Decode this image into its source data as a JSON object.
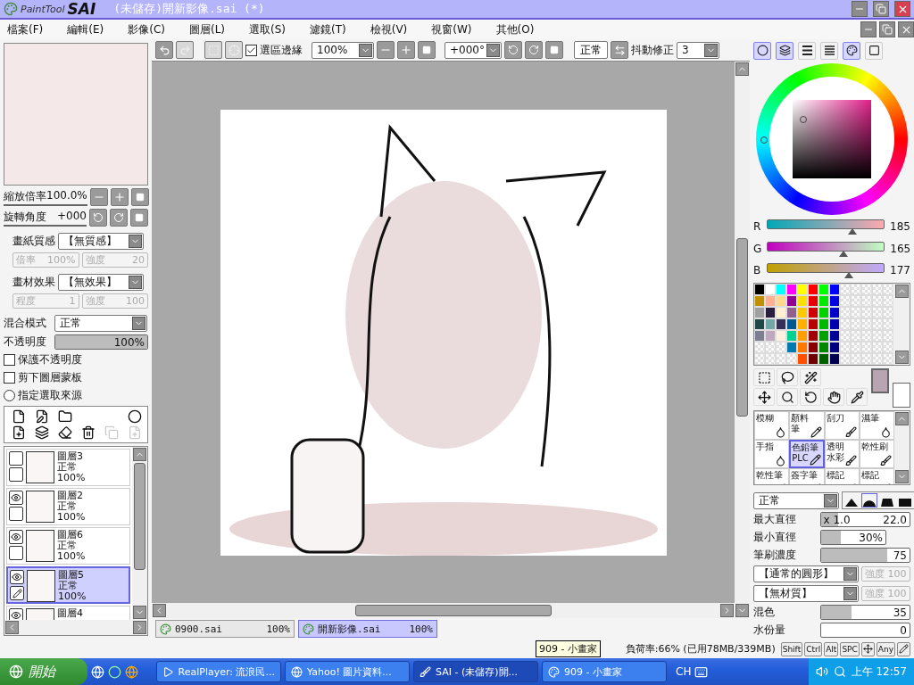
{
  "title_bar": {
    "app_name_1": "PaintTool",
    "app_name_2": "SAI",
    "title": "(未儲存)開新影像.sai (*)"
  },
  "menu": [
    "檔案(F)",
    "編輯(E)",
    "影像(C)",
    "圖層(L)",
    "選取(S)",
    "濾鏡(T)",
    "檢視(V)",
    "視窗(W)",
    "其他(O)"
  ],
  "toolbar": {
    "selection_edge": {
      "label": "選區邊緣",
      "checked": true
    },
    "zoom": "100%",
    "angle": "+000°",
    "blend_button": "正常",
    "stabilizer_label": "抖動修正",
    "stabilizer": "3"
  },
  "navigator": {
    "zoom_label": "縮放倍率",
    "zoom": "100.0%",
    "angle_label": "旋轉角度",
    "angle": "+000"
  },
  "paper": {
    "label": "畫紙質感",
    "value": "【無質感】",
    "sub": [
      {
        "label": "倍率",
        "value": "100%"
      },
      {
        "label": "強度",
        "value": "20"
      }
    ],
    "disabled": true
  },
  "effect": {
    "label": "畫材效果",
    "value": "【無效果】",
    "sub": [
      {
        "label": "程度",
        "value": "1"
      },
      {
        "label": "強度",
        "value": "100"
      }
    ],
    "disabled": true
  },
  "layer_props": {
    "blend_label": "混合模式",
    "blend": "正常",
    "opacity_label": "不透明度",
    "opacity": "100%",
    "level": 1
  },
  "options": [
    {
      "kind": "checkbox",
      "label": "保護不透明度",
      "checked": false
    },
    {
      "kind": "checkbox",
      "label": "剪下圖層蒙板",
      "checked": false
    },
    {
      "kind": "radio",
      "label": "指定選取來源",
      "checked": false
    }
  ],
  "layers": [
    {
      "name": "圖層3",
      "mode": "正常",
      "opacity": "100%",
      "visible": false,
      "selected": false,
      "editing": false
    },
    {
      "name": "圖層2",
      "mode": "正常",
      "opacity": "100%",
      "visible": true,
      "selected": false,
      "editing": false
    },
    {
      "name": "圖層6",
      "mode": "正常",
      "opacity": "100%",
      "visible": true,
      "selected": false,
      "editing": false
    },
    {
      "name": "圖層5",
      "mode": "正常",
      "opacity": "100%",
      "visible": true,
      "selected": true,
      "editing": true
    },
    {
      "name": "圖層4",
      "visible": true,
      "selected": false
    }
  ],
  "document_tabs": [
    {
      "label": "0900.sai",
      "zoom": "100%",
      "selected": false
    },
    {
      "label": "開新影像.sai",
      "zoom": "100%",
      "selected": true
    }
  ],
  "color_modes": [
    {
      "kind": "wheel",
      "selected": true
    },
    {
      "kind": "rgb",
      "selected": true
    },
    {
      "kind": "hsv",
      "selected": false
    },
    {
      "kind": "bars",
      "selected": false
    },
    {
      "kind": "swatches",
      "selected": true
    },
    {
      "kind": "scratchpad",
      "selected": false
    }
  ],
  "rgb": [
    {
      "channel": "R",
      "value": "185",
      "level": 0.725
    },
    {
      "channel": "G",
      "value": "165",
      "level": 0.647
    },
    {
      "channel": "B",
      "value": "177",
      "level": 0.694
    }
  ],
  "palette": [
    [
      {
        "color": "#000000"
      },
      {
        "color": "#ffffff"
      },
      {
        "color": "#00ffff"
      },
      {
        "color": "#ff00ff"
      },
      {
        "color": "#ffff00"
      },
      {
        "color": "#ff0000"
      },
      {
        "color": "#00ff00"
      },
      {
        "color": "#0000ff"
      }
    ],
    [
      {
        "color": "#c09000"
      },
      {
        "color": "#ffb090"
      },
      {
        "color": "#ffd890"
      },
      {
        "color": "#900090"
      },
      {
        "color": "#ffe000"
      },
      {
        "color": "#e80000"
      },
      {
        "color": "#00e800"
      },
      {
        "color": "#0000e0"
      }
    ],
    [
      {
        "color": "#a0a0a0"
      },
      {
        "color": "#2a1e40"
      },
      {
        "color": "#fff0d0"
      },
      {
        "color": "#906090"
      },
      {
        "color": "#ffc800"
      },
      {
        "color": "#d00000"
      },
      {
        "color": "#00d000"
      },
      {
        "color": "#0000c8"
      }
    ],
    [
      {
        "color": "#204848"
      },
      {
        "color": "#70a8a8"
      },
      {
        "color": "#343058"
      },
      {
        "color": "#005890"
      },
      {
        "color": "#ffb000"
      },
      {
        "color": "#b80000"
      },
      {
        "color": "#00b800"
      },
      {
        "color": "#0000b0"
      }
    ],
    [
      {
        "color": "#7a7e90"
      },
      {
        "color": "#c0a8c0"
      },
      {
        "color": "#fff0e0"
      },
      {
        "color": "#00d090"
      },
      {
        "color": "#ffa000"
      },
      {
        "color": "#a00000"
      },
      {
        "color": "#00a000"
      },
      {
        "color": "#000098"
      }
    ],
    [
      {
        "empty": true
      },
      {
        "empty": true
      },
      {
        "empty": true
      },
      {
        "color": "#0078b0"
      },
      {
        "color": "#ff7800"
      },
      {
        "color": "#880000"
      },
      {
        "color": "#008800"
      },
      {
        "color": "#000080"
      }
    ],
    [
      {
        "empty": true
      },
      {
        "empty": true
      },
      {
        "empty": true
      },
      {
        "empty": true
      },
      {
        "color": "#ff5000"
      },
      {
        "color": "#700000"
      },
      {
        "color": "#006000"
      },
      {
        "color": "#000050"
      }
    ]
  ],
  "foreground": {
    "color": "#b9a5b1"
  },
  "brushes": [
    {
      "lines": [
        "模糊"
      ],
      "kind": "wet",
      "selected": false
    },
    {
      "lines": [
        "顏料",
        "筆"
      ],
      "kind": "dry",
      "selected": false
    },
    {
      "lines": [
        "刮刀"
      ],
      "kind": "pen",
      "selected": false
    },
    {
      "lines": [
        "濕筆"
      ],
      "kind": "wet",
      "selected": false
    },
    {
      "lines": [
        "手指"
      ],
      "kind": "wet",
      "selected": false
    },
    {
      "lines": [
        "色鉛筆",
        "PLC"
      ],
      "kind": "dry",
      "selected": true
    },
    {
      "lines": [
        "透明",
        "水彩"
      ],
      "kind": "pen",
      "selected": false
    },
    {
      "lines": [
        "乾性刷"
      ],
      "kind": "pen",
      "selected": false
    },
    {
      "lines": [
        "乾性筆"
      ],
      "kind": "pen",
      "selected": false
    },
    {
      "lines": [
        "簽字筆"
      ],
      "kind": "dry",
      "selected": false
    },
    {
      "lines": [
        "標記"
      ],
      "kind": "pen",
      "selected": false
    },
    {
      "lines": [
        "標記"
      ],
      "kind": "dry",
      "selected": false
    }
  ],
  "brush_settings": {
    "blend": "正常",
    "shapes": [
      {
        "selected": false
      },
      {
        "selected": true
      },
      {
        "selected": false
      },
      {
        "selected": false
      }
    ]
  },
  "sliders": [
    {
      "label": "最大直徑",
      "prefix": "x 1.0",
      "value": "22.0",
      "level": 0.2
    },
    {
      "label": "最小直徑",
      "value": "30%",
      "level": 0.3
    },
    {
      "label": "筆刷濃度",
      "value": "75",
      "level": 0.75
    }
  ],
  "shape_options": [
    {
      "value": "【通常的圓形】",
      "strength": "強度 100",
      "disabled": true
    },
    {
      "value": "【無材質】",
      "strength": "強度 100",
      "disabled": true
    }
  ],
  "sliders2": [
    {
      "label": "混色",
      "value": "35",
      "level": 0.35
    },
    {
      "label": "水份量",
      "value": "0",
      "level": 0
    }
  ],
  "status": {
    "tooltip": "909 - 小畫家",
    "memory": "負荷率:66% (已用78MB/339MB)",
    "keys": [
      "Shift",
      "Ctrl",
      "Alt",
      "SPC"
    ],
    "any_key": "Any"
  },
  "taskbar": {
    "start": "開始",
    "tasks": [
      {
        "label": "RealPlayer: 流浪民...",
        "kind": "player",
        "active": false
      },
      {
        "label": "Yahoo! 圖片資料...",
        "kind": "browser",
        "active": false
      },
      {
        "label": "SAI - (未儲存)開...",
        "kind": "sai",
        "active": true
      },
      {
        "label": "909 - 小畫家",
        "kind": "paint",
        "active": false
      }
    ],
    "lang": "CH",
    "clock": "上午 12:57"
  }
}
